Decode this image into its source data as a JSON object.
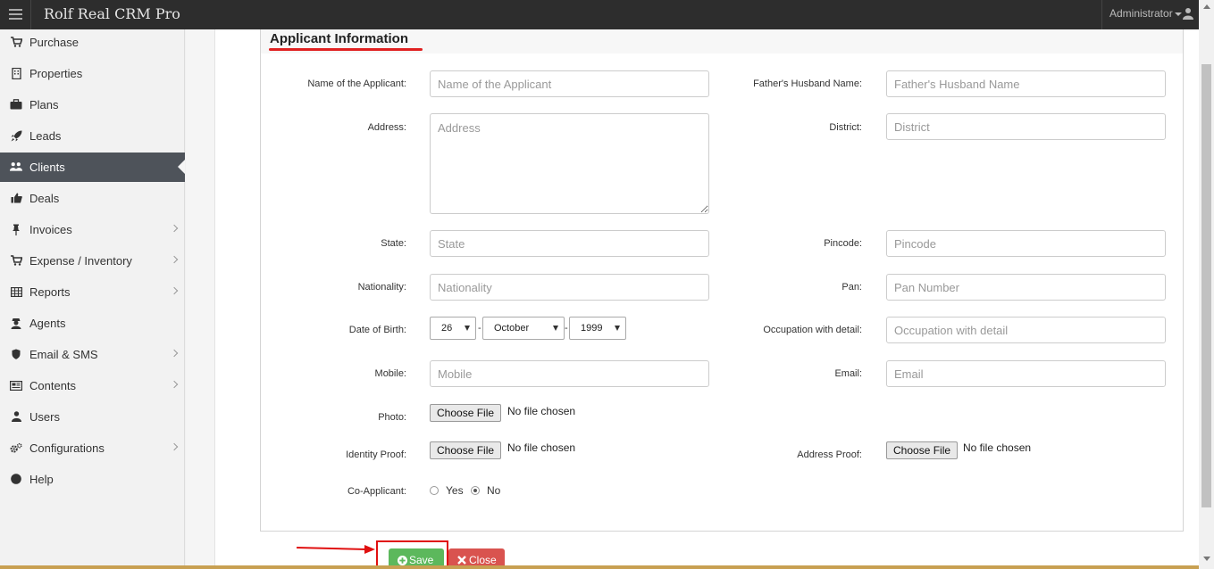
{
  "app": {
    "title": "Rolf Real CRM Pro",
    "user": "Administrator"
  },
  "sidebar": {
    "items": [
      {
        "label": "Purchase",
        "icon": "cart-icon",
        "has_children": false
      },
      {
        "label": "Properties",
        "icon": "building-icon",
        "has_children": false
      },
      {
        "label": "Plans",
        "icon": "briefcase-icon",
        "has_children": false
      },
      {
        "label": "Leads",
        "icon": "rocket-icon",
        "has_children": false
      },
      {
        "label": "Clients",
        "icon": "users-icon",
        "has_children": false,
        "active": true
      },
      {
        "label": "Deals",
        "icon": "thumbs-up-icon",
        "has_children": false
      },
      {
        "label": "Invoices",
        "icon": "pin-icon",
        "has_children": true
      },
      {
        "label": "Expense / Inventory",
        "icon": "cart-icon",
        "has_children": true
      },
      {
        "label": "Reports",
        "icon": "table-icon",
        "has_children": true
      },
      {
        "label": "Agents",
        "icon": "agent-icon",
        "has_children": false
      },
      {
        "label": "Email & SMS",
        "icon": "shield-icon",
        "has_children": true
      },
      {
        "label": "Contents",
        "icon": "newspaper-icon",
        "has_children": true
      },
      {
        "label": "Users",
        "icon": "user-icon",
        "has_children": false
      },
      {
        "label": "Configurations",
        "icon": "cogs-icon",
        "has_children": true
      },
      {
        "label": "Help",
        "icon": "question-icon",
        "has_children": false
      }
    ]
  },
  "form": {
    "section_title": "Applicant Information",
    "applicant_name": {
      "label": "Name of the Applicant:",
      "placeholder": "Name of the Applicant",
      "value": ""
    },
    "father_husband": {
      "label": "Father's Husband Name:",
      "placeholder": "Father's Husband Name",
      "value": ""
    },
    "address": {
      "label": "Address:",
      "placeholder": "Address",
      "value": ""
    },
    "district": {
      "label": "District:",
      "placeholder": "District",
      "value": ""
    },
    "state": {
      "label": "State:",
      "placeholder": "State",
      "value": ""
    },
    "pincode": {
      "label": "Pincode:",
      "placeholder": "Pincode",
      "value": ""
    },
    "nationality": {
      "label": "Nationality:",
      "placeholder": "Nationality",
      "value": ""
    },
    "pan": {
      "label": "Pan:",
      "placeholder": "Pan Number",
      "value": ""
    },
    "dob": {
      "label": "Date of Birth:",
      "day": "26",
      "month": "October",
      "year": "1999",
      "separator": "-"
    },
    "occupation": {
      "label": "Occupation with detail:",
      "placeholder": "Occupation with detail",
      "value": ""
    },
    "mobile": {
      "label": "Mobile:",
      "placeholder": "Mobile",
      "value": ""
    },
    "email": {
      "label": "Email:",
      "placeholder": "Email",
      "value": ""
    },
    "photo": {
      "label": "Photo:",
      "button": "Choose File",
      "status": "No file chosen"
    },
    "identity_proof": {
      "label": "Identity Proof:",
      "button": "Choose File",
      "status": "No file chosen"
    },
    "address_proof": {
      "label": "Address Proof:",
      "button": "Choose File",
      "status": "No file chosen"
    },
    "co_applicant": {
      "label": "Co-Applicant:",
      "options": [
        "Yes",
        "No"
      ],
      "selected": "No"
    }
  },
  "actions": {
    "save_label": "Save",
    "close_label": "Close"
  },
  "colors": {
    "topbar": "#2d2d2d",
    "sidebar_active": "#4e535a",
    "save": "#5cb85c",
    "close": "#d9534f",
    "annotation": "#e01010"
  }
}
